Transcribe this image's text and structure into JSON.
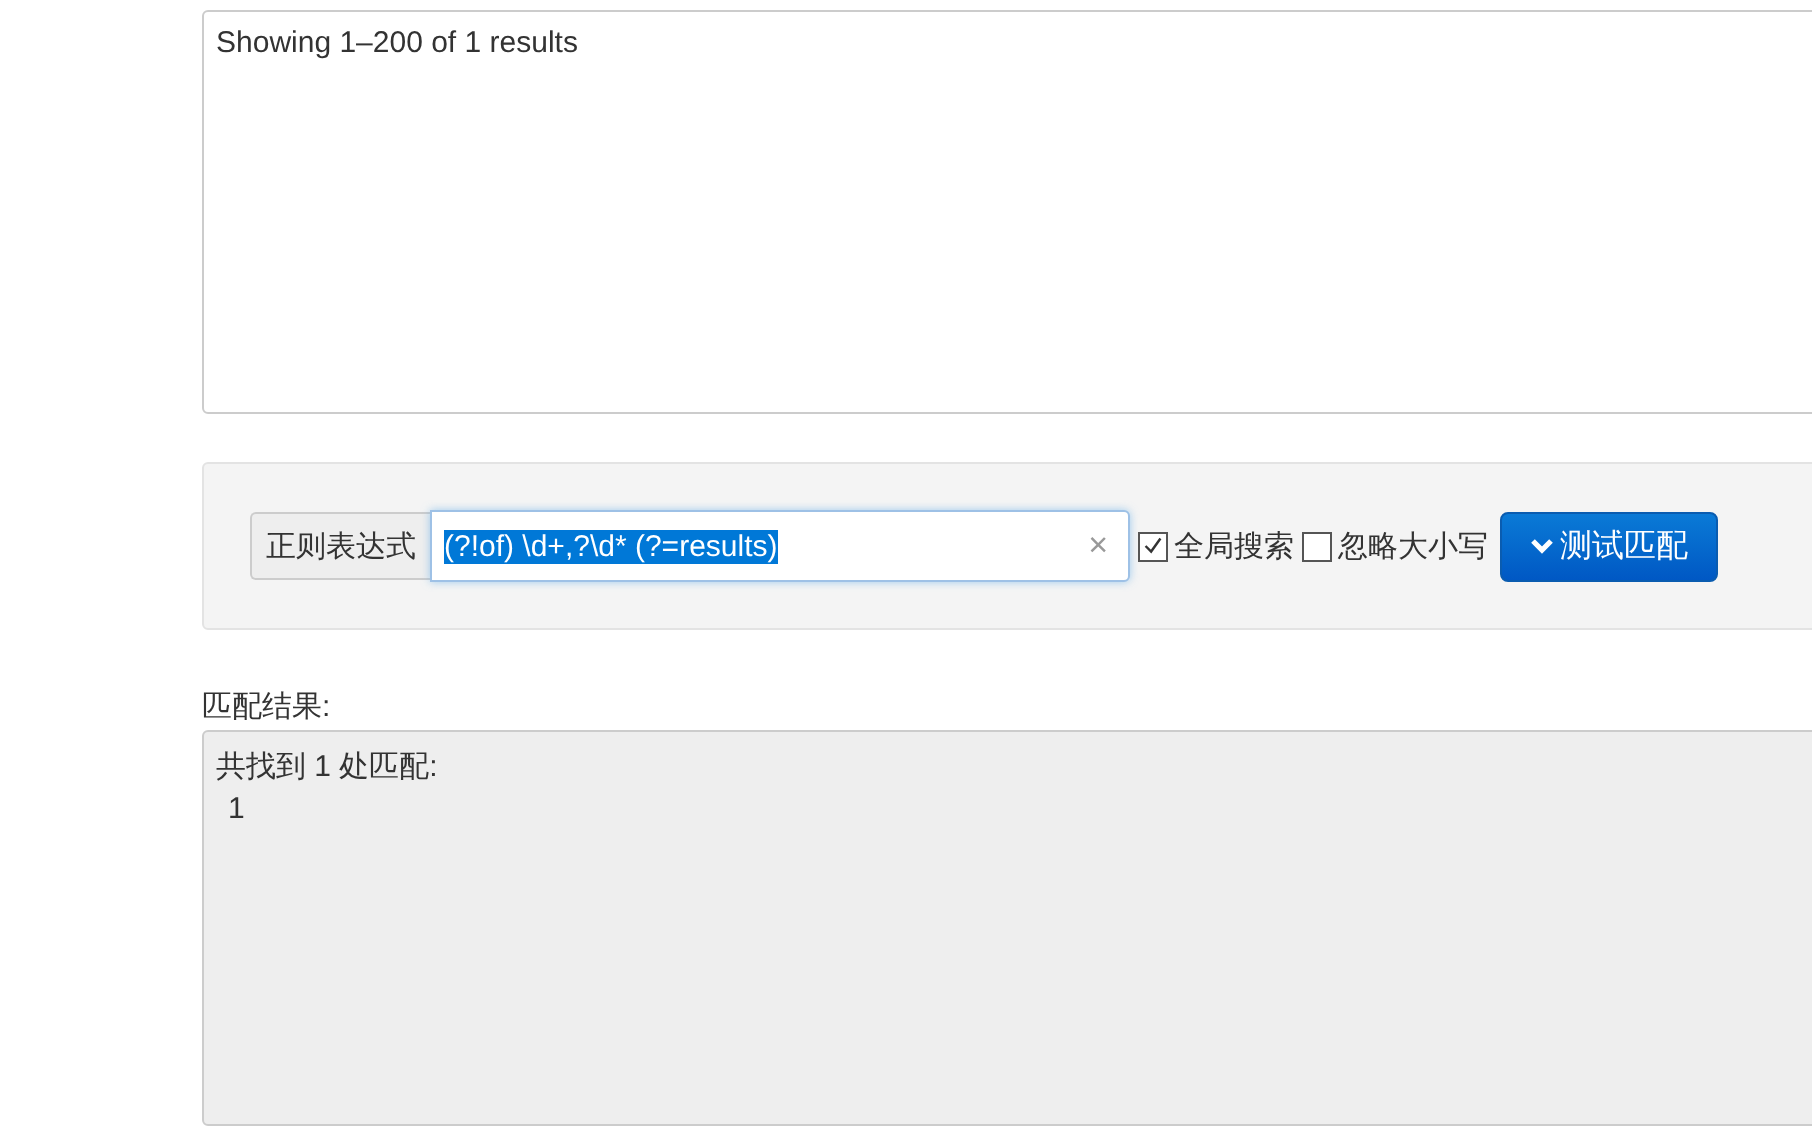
{
  "source_text": {
    "value": "Showing 1–200 of 1 results"
  },
  "regex_bar": {
    "label": "正则表达式",
    "value": "(?!of) \\d+,?\\d* (?=results)",
    "value_highlighted": true,
    "clear": "×",
    "options": [
      {
        "label": "全局搜索",
        "checked": true
      },
      {
        "label": "忽略大小写",
        "checked": false
      }
    ],
    "button": "测试匹配"
  },
  "result": {
    "label": "匹配结果:",
    "summary": "共找到 1 处匹配:",
    "matches": [
      "1"
    ]
  }
}
